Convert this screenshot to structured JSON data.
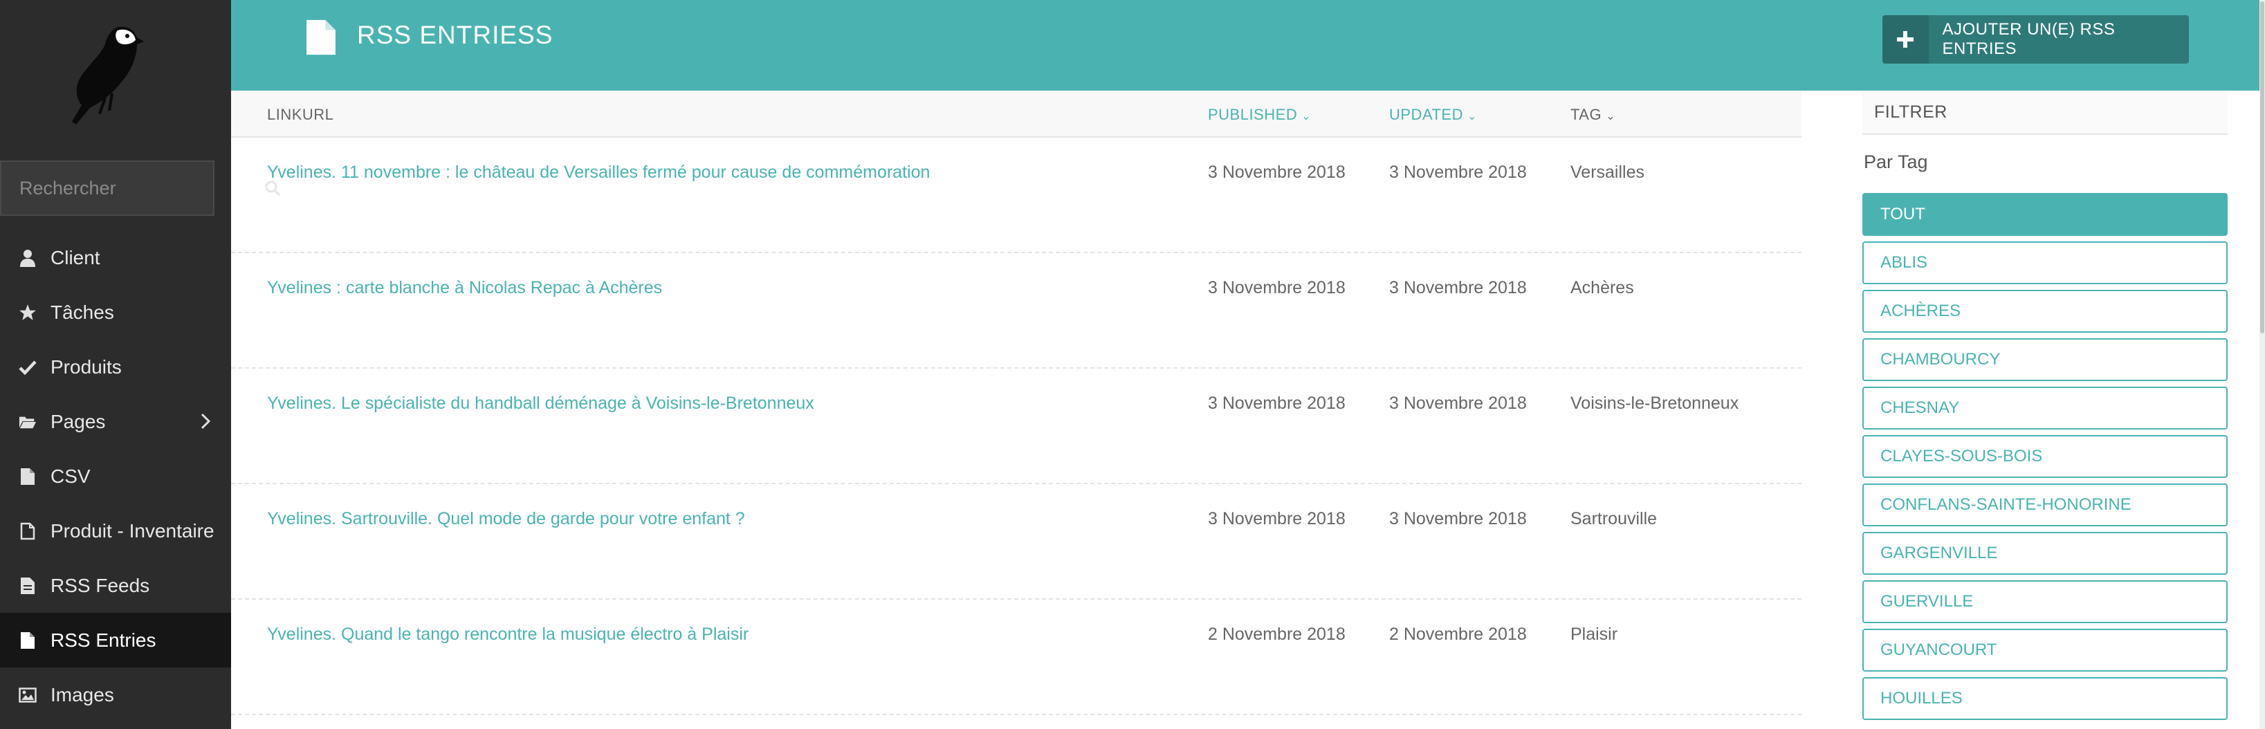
{
  "sidebar": {
    "search": {
      "placeholder": "Rechercher"
    },
    "items": [
      {
        "label": "Client",
        "icon": "user-icon"
      },
      {
        "label": "Tâches",
        "icon": "star-icon"
      },
      {
        "label": "Produits",
        "icon": "check-icon"
      },
      {
        "label": "Pages",
        "icon": "folder-open-icon"
      },
      {
        "label": "CSV",
        "icon": "file-icon"
      },
      {
        "label": "Produit - Inventaire",
        "icon": "file-outline-icon"
      },
      {
        "label": "RSS Feeds",
        "icon": "file-text-icon"
      },
      {
        "label": "RSS Entries",
        "icon": "file-icon"
      },
      {
        "label": "Images",
        "icon": "image-icon"
      }
    ]
  },
  "header": {
    "title": "RSS ENTRIESS",
    "add_button": "AJOUTER UN(E) RSS ENTRIES"
  },
  "table": {
    "columns": {
      "linkurl": "LINKURL",
      "published": "PUBLISHED",
      "updated": "UPDATED",
      "tag": "TAG"
    },
    "rows": [
      {
        "link": "Yvelines. 11 novembre : le château de Versailles fermé pour cause de commémoration",
        "published": "3 Novembre 2018",
        "updated": "3 Novembre 2018",
        "tag": "Versailles"
      },
      {
        "link": "Yvelines : carte blanche à Nicolas Repac à Achères",
        "published": "3 Novembre 2018",
        "updated": "3 Novembre 2018",
        "tag": "Achères"
      },
      {
        "link": "Yvelines. Le spécialiste du handball déménage à Voisins-le-Bretonneux",
        "published": "3 Novembre 2018",
        "updated": "3 Novembre 2018",
        "tag": "Voisins-le-Bretonneux"
      },
      {
        "link": "Yvelines. Sartrouville. Quel mode de garde pour votre enfant ?",
        "published": "3 Novembre 2018",
        "updated": "3 Novembre 2018",
        "tag": "Sartrouville"
      },
      {
        "link": "Yvelines. Quand le tango rencontre la musique électro à Plaisir",
        "published": "2 Novembre 2018",
        "updated": "2 Novembre 2018",
        "tag": "Plaisir"
      }
    ]
  },
  "filter": {
    "title": "FILTRER",
    "subtitle": "Par Tag",
    "tags": [
      "TOUT",
      "ABLIS",
      "ACHÈRES",
      "CHAMBOURCY",
      "CHESNAY",
      "CLAYES-SOUS-BOIS",
      "CONFLANS-SAINTE-HONORINE",
      "GARGENVILLE",
      "GUERVILLE",
      "GUYANCOURT",
      "HOUILLES"
    ]
  },
  "colors": {
    "accent": "#4ab3b2",
    "sidebar_bg": "#2c2c2c",
    "button_dark": "#2e7a79"
  }
}
